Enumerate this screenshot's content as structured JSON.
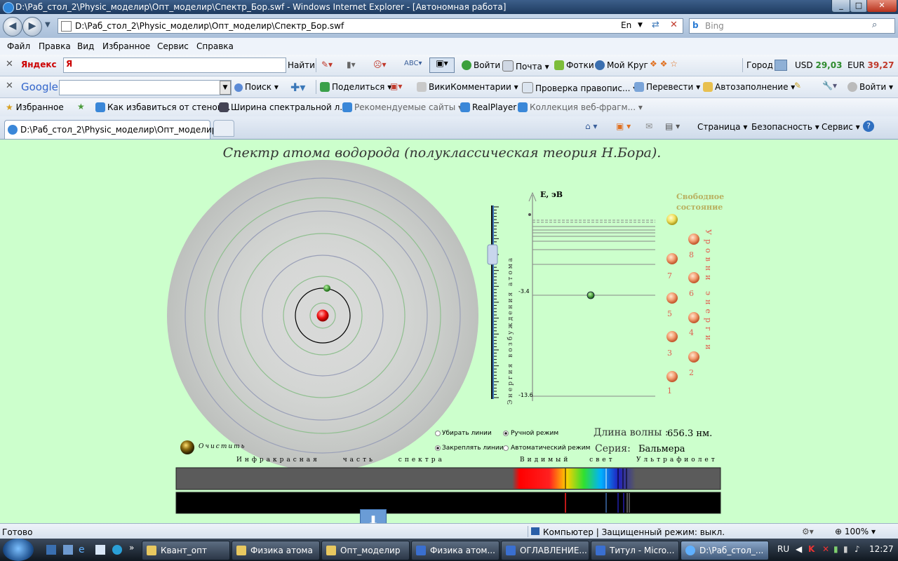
{
  "window": {
    "title": "D:\\Раб_стол_2\\Physic_моделир\\Опт_моделир\\Спектр_Бор.swf - Windows Internet Explorer - [Автономная работа]",
    "min": "_",
    "max": "□",
    "close": "✕"
  },
  "address": {
    "url": "D:\\Раб_стол_2\\Physic_моделир\\Опт_моделир\\Спектр_Бор.swf",
    "lang": "En",
    "search_placeholder": "Bing"
  },
  "menu": [
    "Файл",
    "Правка",
    "Вид",
    "Избранное",
    "Сервис",
    "Справка"
  ],
  "yandex_bar": {
    "brand": "Яндекс",
    "find": "Найти",
    "login": "Войти",
    "mail": "Почта",
    "photos": "Фотки",
    "circle": "Мой Круг",
    "city": "Город",
    "usd_label": "USD",
    "usd": "29,03",
    "eur_label": "EUR",
    "eur": "39,27"
  },
  "google_bar": {
    "brand": "Google",
    "search": "Поиск",
    "share": "Поделиться",
    "wiki": "ВикиКомментарии",
    "spell": "Проверка правопис...",
    "translate": "Перевести",
    "autofill": "Автозаполнение",
    "login": "Войти"
  },
  "favorites": {
    "label": "Избранное",
    "items": [
      "Как избавиться от стенок...",
      "Ширина спектральной л...",
      "Рекомендуемые сайты",
      "RealPlayer",
      "Коллекция веб-фрагм..."
    ]
  },
  "tab": {
    "title": "D:\\Раб_стол_2\\Physic_моделир\\Опт_моделир\\...",
    "tools": [
      "Страница",
      "Безопасность",
      "Сервис"
    ]
  },
  "sim": {
    "title": "Спектр атома водорода (полуклассическая теория Н.Бора).",
    "axis_label": "E, эВ",
    "free_state_1": "Свободное",
    "free_state_2": "состояние",
    "levels_label": "Уровни энергии",
    "excitation_label": "Энергия возбуждения атома",
    "e2": "-3.4",
    "e1": "-13.6",
    "level_numbers": [
      "1",
      "2",
      "3",
      "4",
      "5",
      "6",
      "7",
      "8"
    ],
    "clear": "Очистить",
    "opt_remove": "Убирать линии",
    "opt_fix": "Закреплять линии",
    "opt_manual": "Ручной режим",
    "opt_auto": "Автоматический режим",
    "wavelength_label": "Длина волны :",
    "wavelength_value": "656.3 нм.",
    "series_label": "Серия:",
    "series_value": "Бальмера",
    "ir_label": "Инфракрасная часть спектра",
    "visible_label": "Видимый свет",
    "uv_label": "Ультрафиолет",
    "current_level": 2,
    "excitation_fraction": 0.75
  },
  "status": {
    "left": "Готово",
    "zone": "Компьютер | Защищенный режим: выкл.",
    "zoom": "100%"
  },
  "taskbar": {
    "items": [
      "Квант_опт",
      "Физика атома",
      "Опт_моделир",
      "Физика атом...",
      "ОГЛАВЛЕНИЕ...",
      "Титул - Micro...",
      "D:\\Раб_стол_..."
    ],
    "lang": "RU",
    "clock": "12:27"
  },
  "colors": {
    "sim_bg": "#ccffcc",
    "level_text": "#e06050",
    "free_state": "#b8b060"
  }
}
